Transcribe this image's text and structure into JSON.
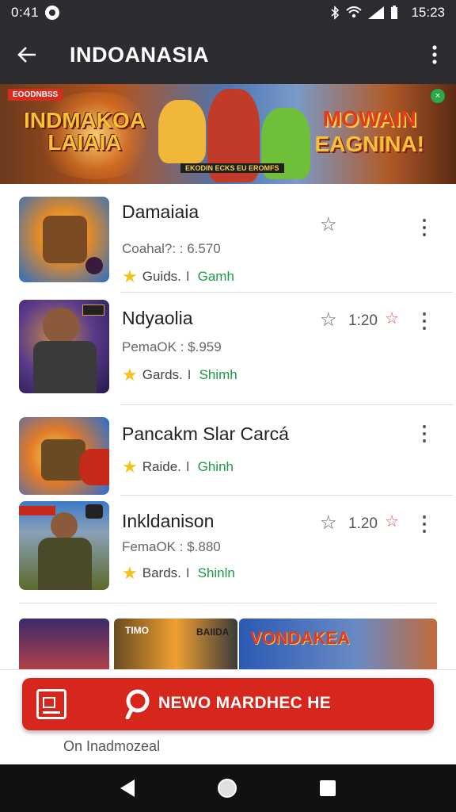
{
  "status_bar": {
    "time": "0:41",
    "clock": "15:23",
    "icons": [
      "bluetooth-icon",
      "wifi-icon",
      "signal-icon",
      "battery-icon"
    ]
  },
  "app_bar": {
    "title": "INDOANASIA",
    "back_icon": "arrow-left-icon",
    "menu_icon": "more-vert-icon"
  },
  "banner": {
    "tag": "EOODNBSS",
    "left_title_line1": "INDMAKOA",
    "left_title_line2": "LAIAIA",
    "right_title_line1": "MOWAIN",
    "right_title_line2": "EAGNINA!",
    "subtitle": "EKODIN ECKS EU EROMFS"
  },
  "items": [
    {
      "name": "Damaiaia",
      "meta": "Coahal?: : 6.570",
      "category": "Guids.",
      "sep": "I",
      "genre": "Gamh",
      "rating": "",
      "thumb_colors": [
        "#f2b23a",
        "#2a7bd4"
      ]
    },
    {
      "name": "Ndyaolia",
      "meta": "PemaOK : $.959",
      "category": "Gards.",
      "sep": "I",
      "genre": "Shimh",
      "rating": "1:20",
      "thumb_colors": [
        "#4b3a8a",
        "#c2702a"
      ]
    },
    {
      "name": "Pancakm Slar Carcá",
      "meta": "",
      "category": "Raide.",
      "sep": "I",
      "genre": "Ghinh",
      "rating": "",
      "thumb_colors": [
        "#2a6fd0",
        "#e0932a"
      ]
    },
    {
      "name": "Inkldanison",
      "meta": "FemaOK : $.880",
      "category": "Bards.",
      "sep": "I",
      "genre": "Shinln",
      "rating": "1.20",
      "thumb_colors": [
        "#5a6a3a",
        "#c04030"
      ]
    }
  ],
  "gallery": {
    "labels": [
      "TIMO",
      "BAIIDA",
      "VONDAKEA"
    ]
  },
  "cta": {
    "label": "NEWO MARDHEC HE",
    "note": "On Inadmozeal"
  },
  "colors": {
    "top_bar": "#2c2c30",
    "accent_red": "#d7261c",
    "genre_green": "#1c9a48",
    "star_yellow": "#f3c21c"
  }
}
